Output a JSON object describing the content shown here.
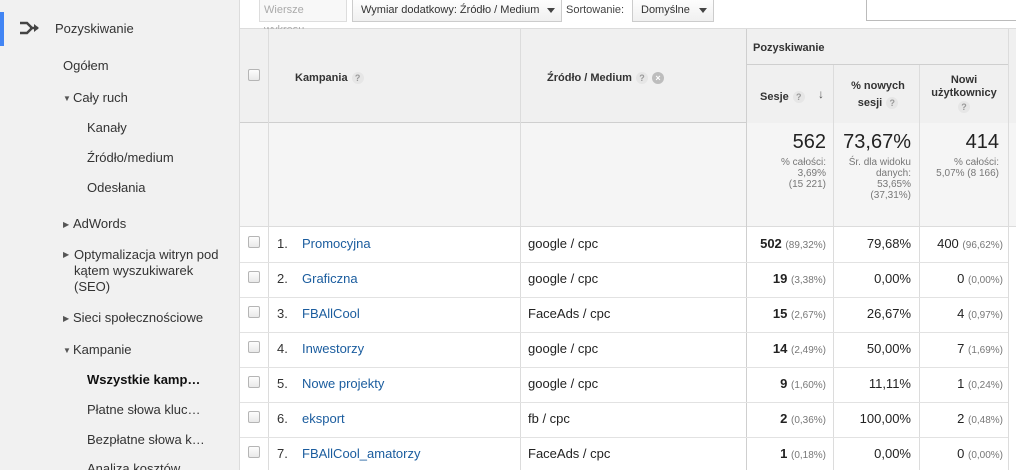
{
  "sidebar": {
    "section_label": "Pozyskiwanie",
    "items": [
      {
        "label": "Ogółem"
      },
      {
        "label": "Cały ruch"
      },
      {
        "label": "Kanały"
      },
      {
        "label": "Źródło/medium"
      },
      {
        "label": "Odesłania"
      },
      {
        "label": "AdWords"
      },
      {
        "label": "Optymalizacja witryn pod kątem wyszukiwarek (SEO)"
      },
      {
        "label": "Sieci społecznościowe"
      },
      {
        "label": "Kampanie"
      },
      {
        "label": "Wszystkie kamp…"
      },
      {
        "label": "Płatne słowa kluc…"
      },
      {
        "label": "Bezpłatne słowa k…"
      },
      {
        "label": "Analiza kosztów…"
      }
    ]
  },
  "toolbar": {
    "chart_rows_label": "Wiersze wykresu",
    "secondary_dim_label": "Wymiar dodatkowy: Źródło / Medium",
    "sort_label": "Sortowanie:",
    "sort_value": "Domyślne"
  },
  "table": {
    "group_header": "Pozyskiwanie",
    "columns": {
      "campaign": "Kampania",
      "source_medium": "Źródło / Medium",
      "sessions": "Sesje",
      "new_sessions_1": "% nowych",
      "new_sessions_2": "sesji",
      "new_users_1": "Nowi",
      "new_users_2": "użytkownicy"
    },
    "summary": {
      "sessions": "562",
      "sessions_sub1": "% całości:",
      "sessions_sub2": "3,69%",
      "sessions_sub3": "(15 221)",
      "new_sessions": "73,67%",
      "new_sessions_sub1": "Śr. dla widoku",
      "new_sessions_sub2": "danych:",
      "new_sessions_sub3": "53,65%",
      "new_sessions_sub4": "(37,31%)",
      "new_users": "414",
      "new_users_sub1": "% całości:",
      "new_users_sub2": "5,07% (8 166)"
    },
    "rows": [
      {
        "idx": "1.",
        "campaign": "Promocyjna",
        "source": "google / cpc",
        "sessions": "502",
        "sessions_pct": "(89,32%)",
        "new_sessions": "79,68%",
        "new_users": "400",
        "new_users_pct": "(96,62%)"
      },
      {
        "idx": "2.",
        "campaign": "Graficzna",
        "source": "google / cpc",
        "sessions": "19",
        "sessions_pct": "(3,38%)",
        "new_sessions": "0,00%",
        "new_users": "0",
        "new_users_pct": "(0,00%)"
      },
      {
        "idx": "3.",
        "campaign": "FBAllCool",
        "source": "FaceAds / cpc",
        "sessions": "15",
        "sessions_pct": "(2,67%)",
        "new_sessions": "26,67%",
        "new_users": "4",
        "new_users_pct": "(0,97%)"
      },
      {
        "idx": "4.",
        "campaign": "Inwestorzy",
        "source": "google / cpc",
        "sessions": "14",
        "sessions_pct": "(2,49%)",
        "new_sessions": "50,00%",
        "new_users": "7",
        "new_users_pct": "(1,69%)"
      },
      {
        "idx": "5.",
        "campaign": "Nowe projekty",
        "source": "google / cpc",
        "sessions": "9",
        "sessions_pct": "(1,60%)",
        "new_sessions": "11,11%",
        "new_users": "1",
        "new_users_pct": "(0,24%)"
      },
      {
        "idx": "6.",
        "campaign": "eksport",
        "source": "fb / cpc",
        "sessions": "2",
        "sessions_pct": "(0,36%)",
        "new_sessions": "100,00%",
        "new_users": "2",
        "new_users_pct": "(0,48%)"
      },
      {
        "idx": "7.",
        "campaign": "FBAllCool_amatorzy",
        "source": "FaceAds / cpc",
        "sessions": "1",
        "sessions_pct": "(0,18%)",
        "new_sessions": "0,00%",
        "new_users": "0",
        "new_users_pct": "(0,00%)"
      }
    ]
  }
}
